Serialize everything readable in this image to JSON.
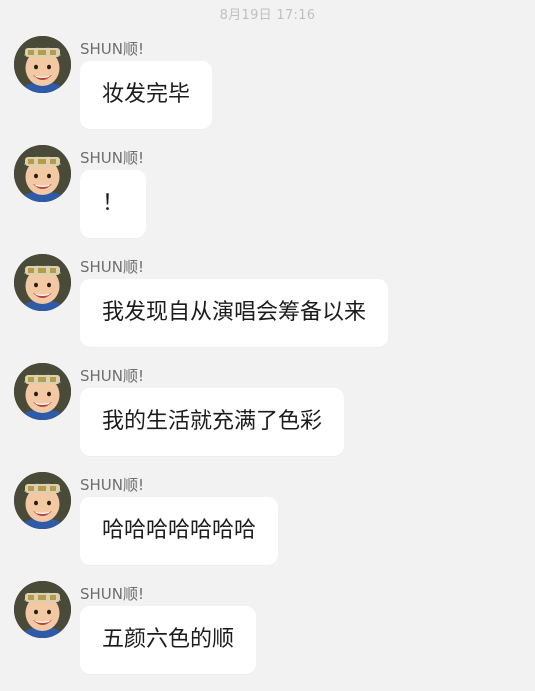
{
  "timestamp": "8月19日 17:16",
  "messages": [
    {
      "sender": "SHUN顺!",
      "text": "妆发完毕"
    },
    {
      "sender": "SHUN顺!",
      "text": "！"
    },
    {
      "sender": "SHUN顺!",
      "text": "我发现自从演唱会筹备以来"
    },
    {
      "sender": "SHUN顺!",
      "text": "我的生活就充满了色彩"
    },
    {
      "sender": "SHUN顺!",
      "text": "哈哈哈哈哈哈哈"
    },
    {
      "sender": "SHUN顺!",
      "text": "五颜六色的顺"
    }
  ]
}
